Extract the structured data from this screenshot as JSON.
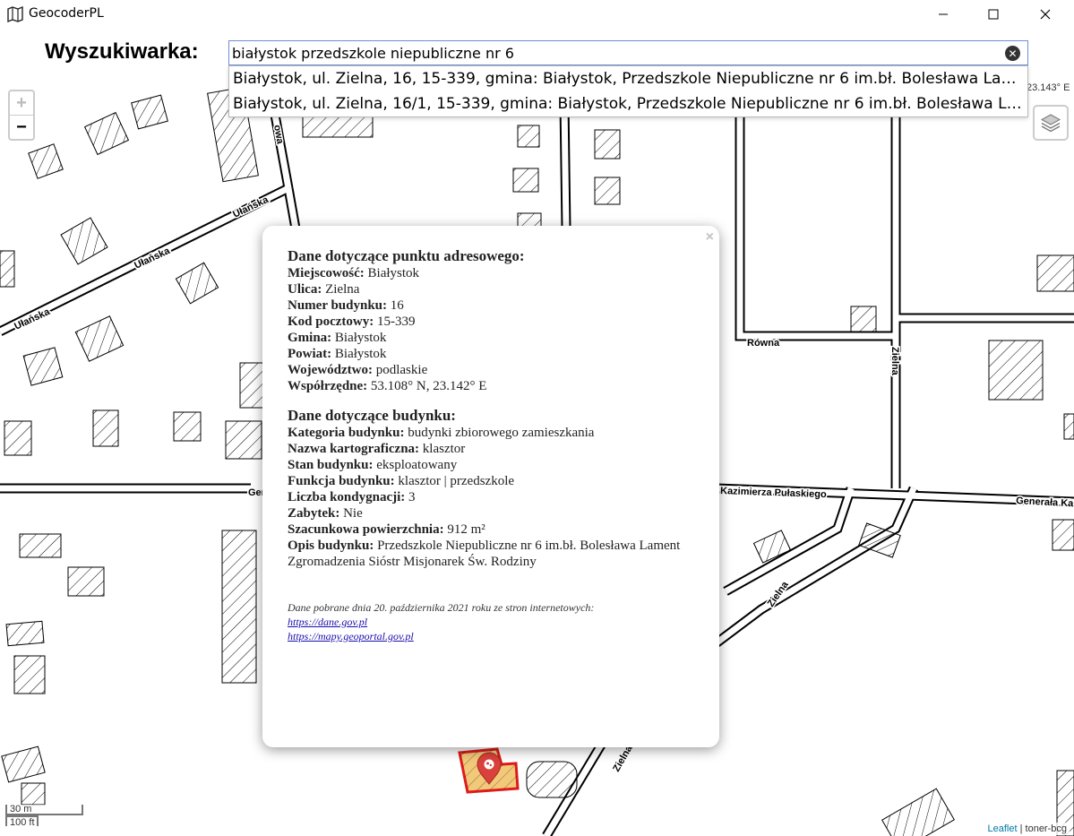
{
  "window": {
    "title": "GeocoderPL",
    "icon": "map-icon",
    "buttons": [
      "minimize",
      "maximize",
      "close"
    ]
  },
  "search": {
    "label": "Wyszukiwarka:",
    "value": "białystok przedszkole niepubliczne nr 6",
    "suggestions": [
      "Białystok, ul. Zielna, 16, 15-339, gmina: Białystok, Przedszkole Niepubliczne nr 6 im.bł. Bolesława Lament Zgromadzenia Sióstr Misjonarek Św. Rodziny",
      "Białystok, ul. Zielna, 16/1, 15-339, gmina: Białystok, Przedszkole Niepubliczne nr 6 im.bł. Bolesława Lament Zgromadzenia Sióstr Misjonarek Św. Rodziny"
    ]
  },
  "map": {
    "zoom_in": "+",
    "zoom_out": "−",
    "coords_fragment": "23.143° E",
    "scale_metric": "30 m",
    "scale_imperial": "100 ft",
    "attribution_link": "Leaflet",
    "attribution_text": "| toner-bcg",
    "street_labels": {
      "ulanska1": "Ułańska",
      "ulanska2": "Ułańska",
      "ulanska3": "Ułańska",
      "owa": "owa",
      "rowna": "Równa",
      "zielna1": "Zielna",
      "zielna2": "Zielna",
      "zielna3": "Zielna",
      "pulaskiego": "Kazimierza Pułaskiego",
      "generala_left": "Genera",
      "generala_right": "Generała Ka"
    }
  },
  "popup": {
    "close": "×",
    "address_heading": "Dane dotyczące punktu adresowego:",
    "address_rows": [
      {
        "k": "Miejscowość:",
        "v": "Białystok"
      },
      {
        "k": "Ulica:",
        "v": "Zielna"
      },
      {
        "k": "Numer budynku:",
        "v": "16"
      },
      {
        "k": "Kod pocztowy:",
        "v": "15-339"
      },
      {
        "k": "Gmina:",
        "v": "Białystok"
      },
      {
        "k": "Powiat:",
        "v": "Białystok"
      },
      {
        "k": "Województwo:",
        "v": "podlaskie"
      },
      {
        "k": "Współrzędne:",
        "v": "53.108° N, 23.142° E"
      }
    ],
    "building_heading": "Dane dotyczące budynku:",
    "building_rows": [
      {
        "k": "Kategoria budynku:",
        "v": "budynki zbiorowego zamieszkania"
      },
      {
        "k": "Nazwa kartograficzna:",
        "v": "klasztor"
      },
      {
        "k": "Stan budynku:",
        "v": "eksploatowany"
      },
      {
        "k": "Funkcja budynku:",
        "v": "klasztor | przedszkole"
      },
      {
        "k": "Liczba kondygnacji:",
        "v": "3"
      },
      {
        "k": "Zabytek:",
        "v": "Nie"
      },
      {
        "k": "Szacunkowa powierzchnia:",
        "v": "912 m²"
      },
      {
        "k": "Opis budynku:",
        "v": "Przedszkole Niepubliczne nr 6 im.bł. Bolesława Lament Zgromadzenia Sióstr Misjonarek Św. Rodziny"
      }
    ],
    "source_note": "Dane pobrane dnia 20. października 2021 roku ze stron internetowych:",
    "source_links": [
      "https://dane.gov.pl",
      "https://mapy.geoportal.gov.pl"
    ]
  },
  "colors": {
    "marker": "#d9413a",
    "selected_building_fill": "#f2c879",
    "selected_building_stroke": "#e01b1b"
  }
}
